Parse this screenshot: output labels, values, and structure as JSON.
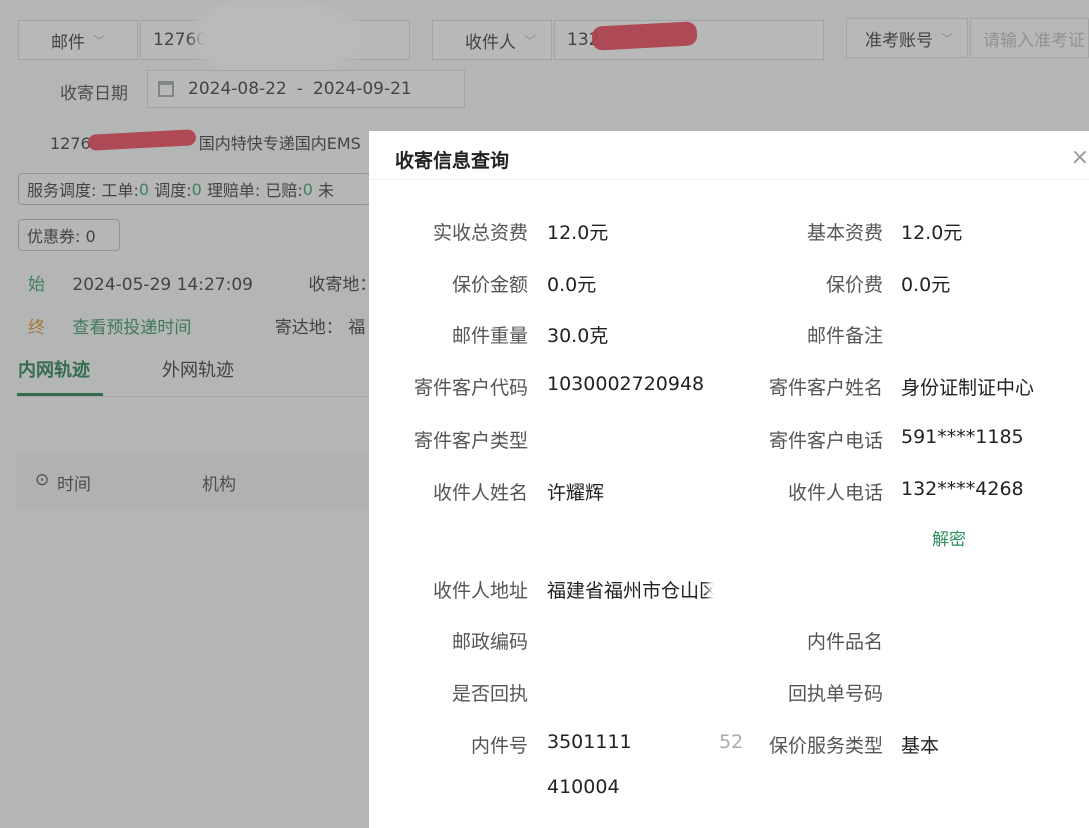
{
  "search": {
    "type1": "邮件",
    "value1": "12760",
    "type2": "收件人",
    "value2": "132",
    "type3": "准考账号",
    "placeholder3": "请输入准考证"
  },
  "date_filter": {
    "label": "收寄日期",
    "start": "2024-08-22",
    "separator": "-",
    "end": "2024-09-21"
  },
  "mail_summary": "国内特快专递国内EMS",
  "mail_number_prefix": "1276",
  "service_status": {
    "label": "服务调度:",
    "ticket_label": "工单:",
    "ticket_value": "0",
    "dispatch_label": "调度:",
    "dispatch_value": "0",
    "claim_label": "理赔单: 已赔:",
    "claim_value": "0",
    "unclaimed_label": "未"
  },
  "coupon": "优惠券: 0",
  "track": {
    "start_badge": "始",
    "start_time": "2024-05-29 14:27:09",
    "origin_label": "收寄地：",
    "end_badge": "终",
    "eta_link": "查看预投递时间",
    "dest_label": "寄达地：",
    "dest_value": "福"
  },
  "tabs": [
    "内网轨迹",
    "外网轨迹"
  ],
  "table_headers": [
    "时间",
    "机构"
  ],
  "modal": {
    "title": "收寄信息查询",
    "close": "×",
    "fields": {
      "actual_total_fee_label": "实收总资费",
      "actual_total_fee_value": "12.0元",
      "base_fee_label": "基本资费",
      "base_fee_value": "12.0元",
      "insured_amount_label": "保价金额",
      "insured_amount_value": "0.0元",
      "insured_fee_label": "保价费",
      "insured_fee_value": "0.0元",
      "weight_label": "邮件重量",
      "weight_value": "30.0克",
      "remark_label": "邮件备注",
      "sender_code_label": "寄件客户代码",
      "sender_code_value": "1030002720948",
      "sender_name_label": "寄件客户姓名",
      "sender_name_value": "身份证制证中心",
      "sender_type_label": "寄件客户类型",
      "sender_phone_label": "寄件客户电话",
      "sender_phone_value": "591****1185",
      "receiver_name_label": "收件人姓名",
      "receiver_name_value": "许耀辉",
      "receiver_phone_label": "收件人电话",
      "receiver_phone_value": "132****4268",
      "decrypt_link": "解密",
      "receiver_address_label": "收件人地址",
      "receiver_address_value": "福建省福州市仓山区福工",
      "postcode_label": "邮政编码",
      "content_name_label": "内件品名",
      "return_receipt_label": "是否回执",
      "return_receipt_no_label": "回执单号码",
      "content_no_label": "内件号",
      "content_no_value": "3501111",
      "content_no_suffix": "52",
      "content_no_value2": "410004",
      "insurance_type_label": "保价服务类型",
      "insurance_type_value": "基本"
    }
  }
}
